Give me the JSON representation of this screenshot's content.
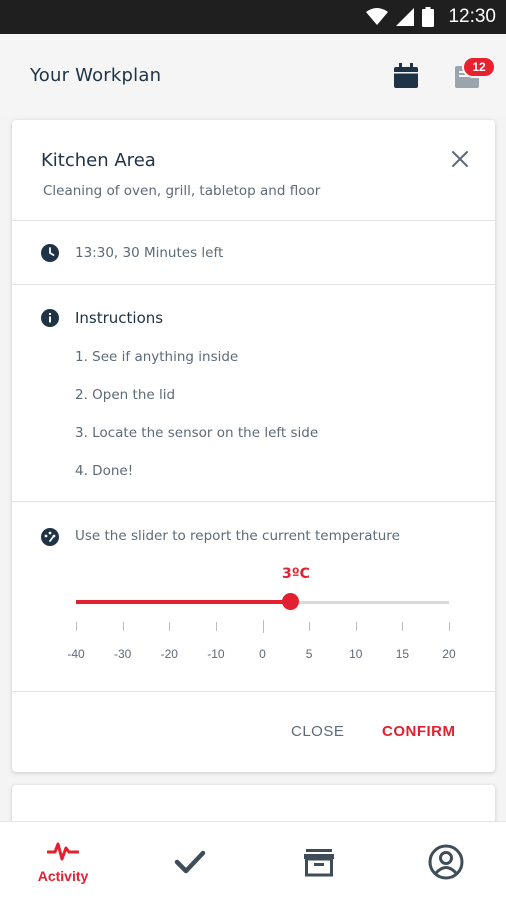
{
  "status_bar": {
    "time": "12:30"
  },
  "header": {
    "title": "Your Workplan",
    "notification_count": "12"
  },
  "task_card": {
    "title": "Kitchen Area",
    "subtitle": "Cleaning of oven, grill, tabletop and floor",
    "time_info": "13:30, 30 Minutes left",
    "instructions": {
      "title": "Instructions",
      "steps": [
        "1. See if anything inside",
        "2. Open the lid",
        "3. Locate the sensor on the left side",
        "4. Done!"
      ]
    },
    "temperature": {
      "prompt": "Use the slider to report the current temperature",
      "value_label": "3ºC",
      "value": 3,
      "min": -40,
      "max": 20,
      "tick_labels": [
        "-40",
        "-30",
        "-20",
        "-10",
        "0",
        "5",
        "10",
        "15",
        "20"
      ]
    },
    "actions": {
      "close_label": "CLOSE",
      "confirm_label": "CONFIRM"
    }
  },
  "bottom_nav": {
    "items": [
      {
        "label": "Activity",
        "icon": "activity-pulse-icon",
        "active": true
      },
      {
        "label": "",
        "icon": "checkmark-icon",
        "active": false
      },
      {
        "label": "",
        "icon": "archive-icon",
        "active": false
      },
      {
        "label": "",
        "icon": "profile-icon",
        "active": false
      }
    ]
  },
  "colors": {
    "accent": "#e3202f",
    "title": "#1e3346",
    "secondary_text": "#5c6b78"
  }
}
